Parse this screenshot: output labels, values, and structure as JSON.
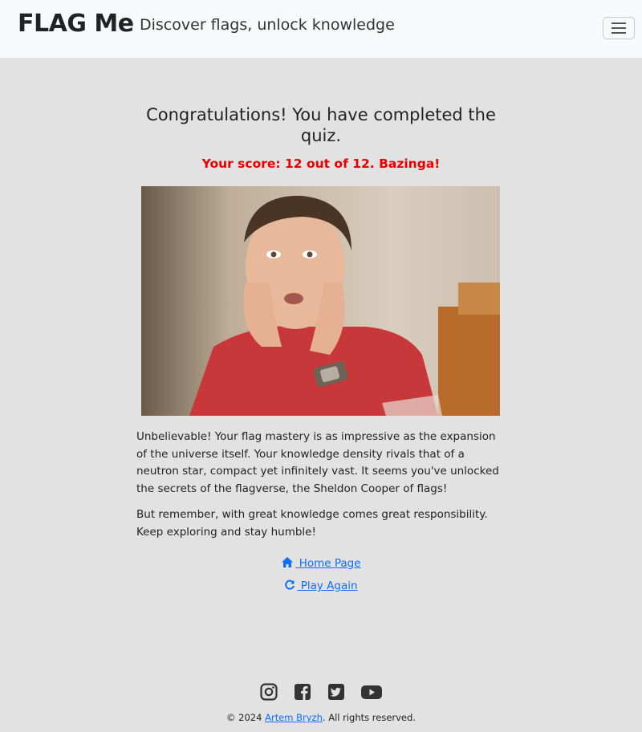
{
  "header": {
    "brand": "FLAG Me",
    "tagline": "Discover flags, unlock knowledge",
    "menu_icon": "hamburger-icon"
  },
  "result": {
    "title": "Congratulations! You have completed the quiz.",
    "score": "Your score: 12 out of 12. Bazinga!",
    "score_color": "#e60000",
    "image_description": "sheldon-amazed-photo",
    "paragraph1": "Unbelievable! Your flag mastery is as impressive as the expansion of the universe itself. Your knowledge density rivals that of a neutron star, compact yet infinitely vast. It seems you've unlocked the secrets of the flagverse, the Sheldon Cooper of flags!",
    "paragraph2": "But remember, with great knowledge comes great responsibility. Keep exploring and stay humble!"
  },
  "links": {
    "home": " Home Page",
    "home_icon": "home-icon",
    "play_again": " Play Again",
    "play_again_icon": "refresh-icon"
  },
  "footer": {
    "social_icons": [
      "instagram-icon",
      "facebook-icon",
      "twitter-icon",
      "youtube-icon"
    ],
    "copyright_prefix": "© 2024 ",
    "author": "Artem Bryzh",
    "copyright_suffix": ". All rights reserved."
  },
  "colors": {
    "background": "#e2e2e2",
    "navbar": "#f8f9fa",
    "link": "#0d6efd"
  }
}
